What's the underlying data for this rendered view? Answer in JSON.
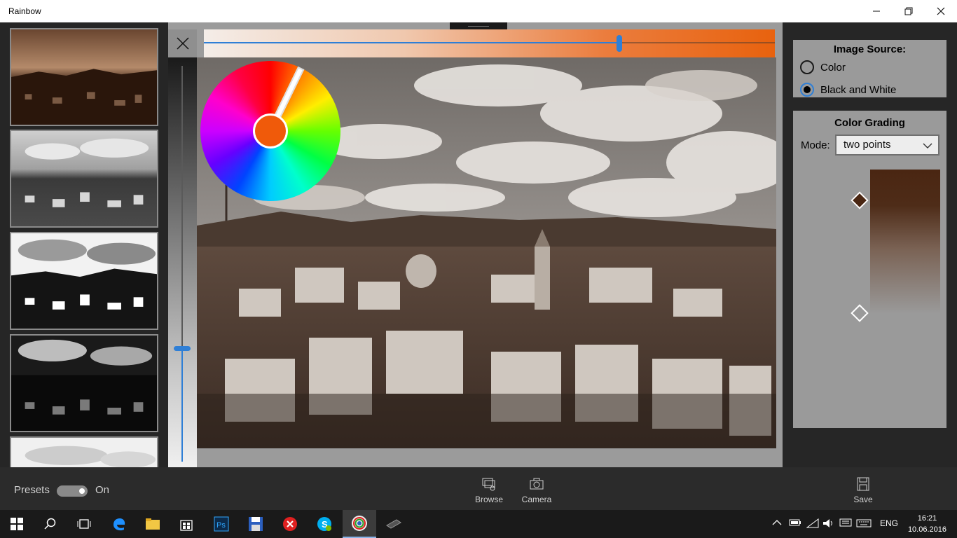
{
  "window": {
    "title": "Rainbow"
  },
  "editor": {
    "close_icon": "close-icon",
    "hue_slider_value": 0.72,
    "vertical_slider_value": 0.28,
    "color_wheel_hue_deg": 26,
    "selected_color": "#f05a0a"
  },
  "thumbnails": [
    {
      "name": "preset-sepia"
    },
    {
      "name": "preset-gray"
    },
    {
      "name": "preset-high-contrast"
    },
    {
      "name": "preset-dark"
    },
    {
      "name": "preset-bright"
    }
  ],
  "image_source": {
    "title": "Image Source:",
    "options": [
      {
        "label": "Color",
        "selected": false
      },
      {
        "label": "Black and White",
        "selected": true
      }
    ]
  },
  "color_grading": {
    "title": "Color Grading",
    "mode_label": "Mode:",
    "mode_value": "two points",
    "point_top_color": "#4a2612",
    "point_bottom_color": "#ffffff"
  },
  "command_bar": {
    "presets_label": "Presets",
    "presets_toggle": "On",
    "browse_label": "Browse",
    "camera_label": "Camera",
    "save_label": "Save"
  },
  "taskbar": {
    "language": "ENG",
    "time": "16:21",
    "date": "10.06.2016",
    "apps": [
      "start",
      "search",
      "task-view",
      "edge",
      "file-explorer",
      "store",
      "photoshop",
      "save-disk",
      "close-app",
      "skype",
      "rainbow",
      "usb-drive"
    ]
  }
}
